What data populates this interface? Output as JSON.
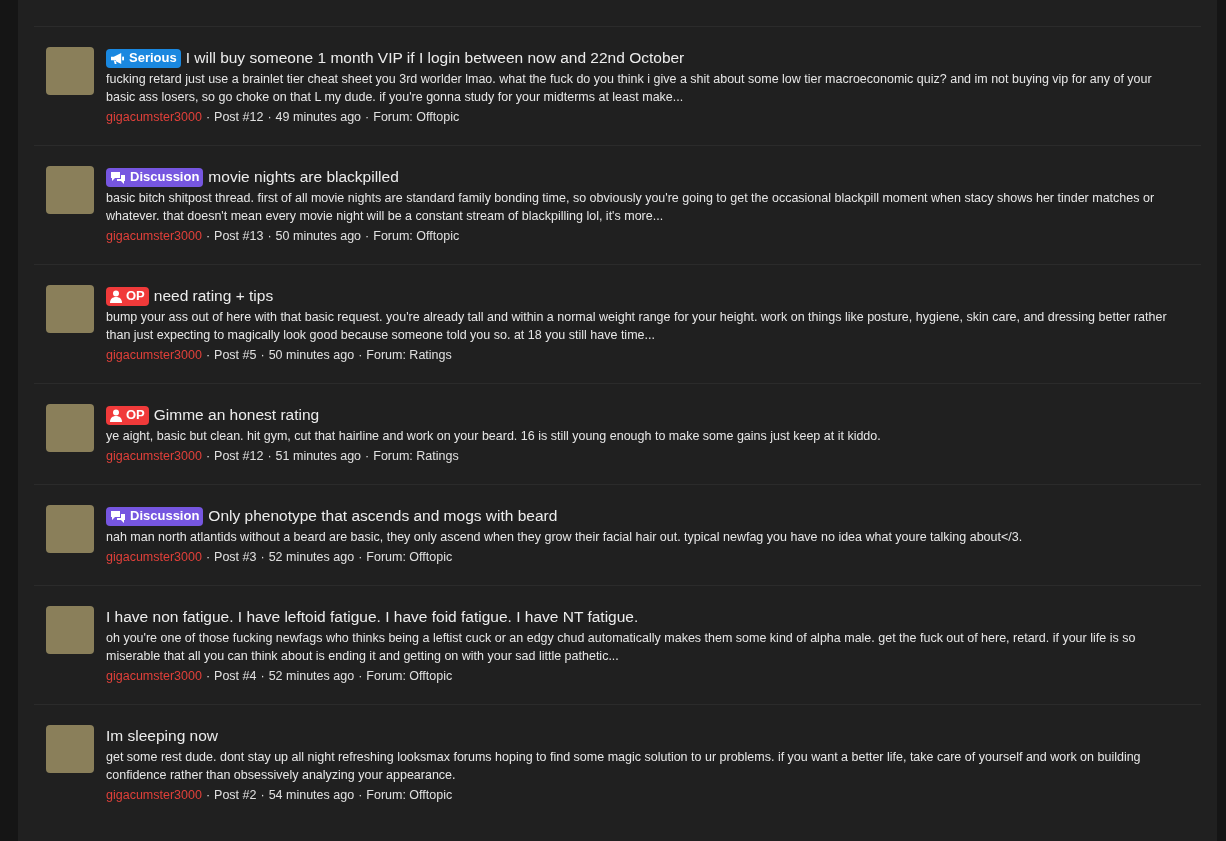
{
  "posts": [
    {
      "prefix": {
        "kind": "serious",
        "label": "Serious"
      },
      "title": "I will buy someone 1 month VIP if I login between now and 22nd October",
      "snippet": "fucking retard just use a brainlet tier cheat sheet you 3rd worlder lmao. what the fuck do you think i give a shit about some low tier macroeconomic quiz? and im not buying vip for any of your basic ass losers, so go choke on that L my dude. if you're gonna study for your midterms at least make...",
      "author": "gigacumster3000",
      "post": "Post #12",
      "separator": "·",
      "time": "49 minutes ago",
      "forum": "Forum: Offtopic"
    },
    {
      "prefix": {
        "kind": "discussion",
        "label": "Discussion"
      },
      "title": "movie nights are blackpilled",
      "snippet": "basic bitch shitpost thread. first of all movie nights are standard family bonding time, so obviously you're going to get the occasional blackpill moment when stacy shows her tinder matches or whatever. that doesn't mean every movie night will be a constant stream of blackpilling lol, it's more...",
      "author": "gigacumster3000",
      "post": "Post #13",
      "separator": "·",
      "time": "50 minutes ago",
      "forum": "Forum: Offtopic"
    },
    {
      "prefix": {
        "kind": "op",
        "label": "OP"
      },
      "title": "need rating + tips",
      "snippet": "bump your ass out of here with that basic request. you're already tall and within a normal weight range for your height. work on things like posture, hygiene, skin care, and dressing better rather than just expecting to magically look good because someone told you so. at 18 you still have time...",
      "author": "gigacumster3000",
      "post": "Post #5",
      "separator": "·",
      "time": "50 minutes ago",
      "forum": "Forum: Ratings"
    },
    {
      "prefix": {
        "kind": "op",
        "label": "OP"
      },
      "title": "Gimme an honest rating",
      "snippet": "ye aight, basic but clean. hit gym, cut that hairline and work on your beard. 16 is still young enough to make some gains just keep at it kiddo.",
      "author": "gigacumster3000",
      "post": "Post #12",
      "separator": "·",
      "time": "51 minutes ago",
      "forum": "Forum: Ratings"
    },
    {
      "prefix": {
        "kind": "discussion",
        "label": "Discussion"
      },
      "title": "Only phenotype that ascends and mogs with beard",
      "snippet": "nah man north atlantids without a beard are basic, they only ascend when they grow their facial hair out. typical newfag you have no idea what youre talking about</3.",
      "author": "gigacumster3000",
      "post": "Post #3",
      "separator": "·",
      "time": "52 minutes ago",
      "forum": "Forum: Offtopic"
    },
    {
      "title": "I have non fatigue. I have leftoid fatigue. I have foid fatigue. I have NT fatigue.",
      "snippet": "oh you're one of those fucking newfags who thinks being a leftist cuck or an edgy chud automatically makes them some kind of alpha male. get the fuck out of here, retard. if your life is so miserable that all you can think about is ending it and getting on with your sad little pathetic...",
      "author": "gigacumster3000",
      "post": "Post #4",
      "separator": "·",
      "time": "52 minutes ago",
      "forum": "Forum: Offtopic"
    },
    {
      "title": "Im sleeping now",
      "snippet": "get some rest dude. dont stay up all night refreshing looksmax forums hoping to find some magic solution to ur problems. if you want a better life, take care of yourself and work on building confidence rather than obsessively analyzing your appearance.",
      "author": "gigacumster3000",
      "post": "Post #2",
      "separator": "·",
      "time": "54 minutes ago",
      "forum": "Forum: Offtopic"
    }
  ]
}
